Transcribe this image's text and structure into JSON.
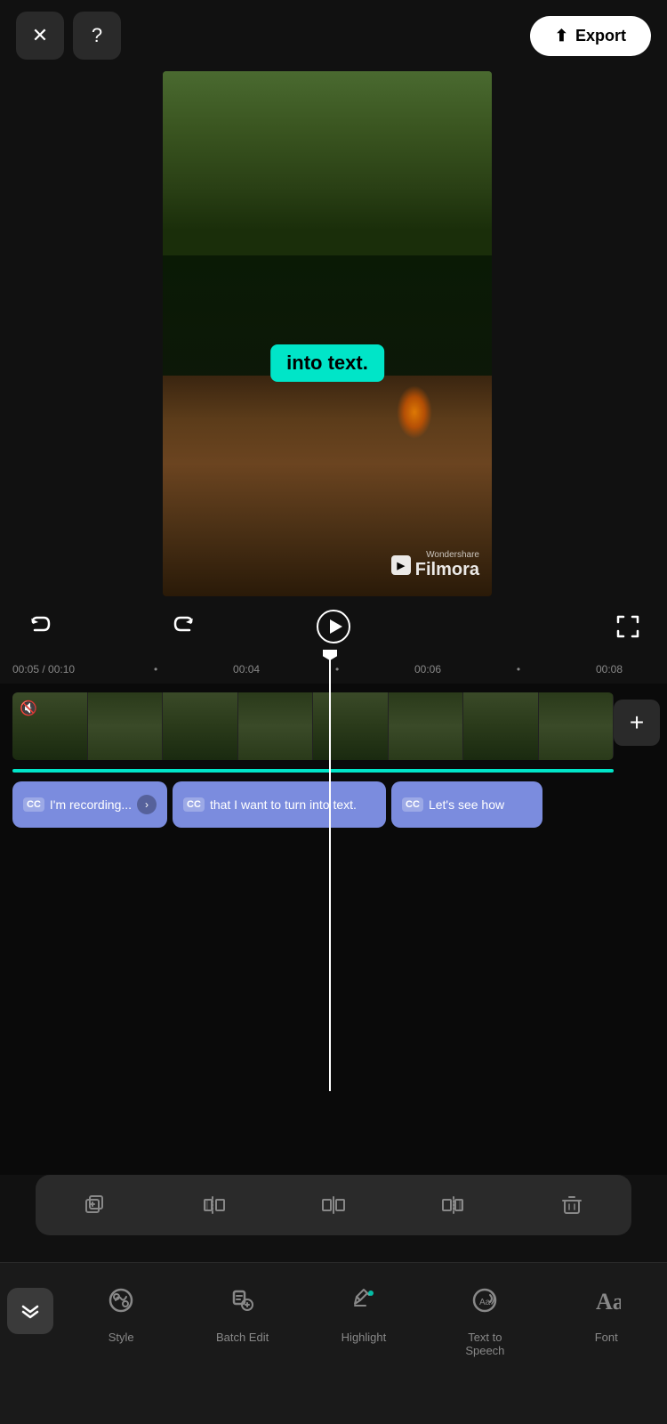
{
  "topBar": {
    "closeLabel": "✕",
    "helpLabel": "?",
    "exportLabel": "Export",
    "exportIcon": "↑"
  },
  "videoPreview": {
    "subtitleText": "into text.",
    "watermarkBrand": "Filmora",
    "watermarkCompany": "Wondershare"
  },
  "playback": {
    "undoLabel": "↺",
    "redoLabel": "↻",
    "playLabel": "▶",
    "fullscreenLabel": "⛶"
  },
  "timeline": {
    "currentTime": "00:05",
    "totalTime": "00:10",
    "markers": [
      "00:04",
      "00:06",
      "00:08"
    ]
  },
  "captions": [
    {
      "id": 1,
      "text": "I'm recording...",
      "hasArrow": true
    },
    {
      "id": 2,
      "text": "that I want to turn into text.",
      "hasArrow": false
    },
    {
      "id": 3,
      "text": "Let's see how",
      "hasArrow": false
    }
  ],
  "editToolbar": {
    "tools": [
      "copy",
      "trim-start",
      "trim-end",
      "trim-both",
      "delete"
    ]
  },
  "bottomNav": {
    "collapseLabel": "⌄⌄",
    "items": [
      {
        "id": "style",
        "label": "Style",
        "icon": "style"
      },
      {
        "id": "batch-edit",
        "label": "Batch Edit",
        "icon": "batch-edit"
      },
      {
        "id": "highlight",
        "label": "Highlight",
        "icon": "highlight"
      },
      {
        "id": "text-to-speech",
        "label": "Text to Speech",
        "icon": "tts"
      },
      {
        "id": "font",
        "label": "Font",
        "icon": "font"
      }
    ]
  }
}
